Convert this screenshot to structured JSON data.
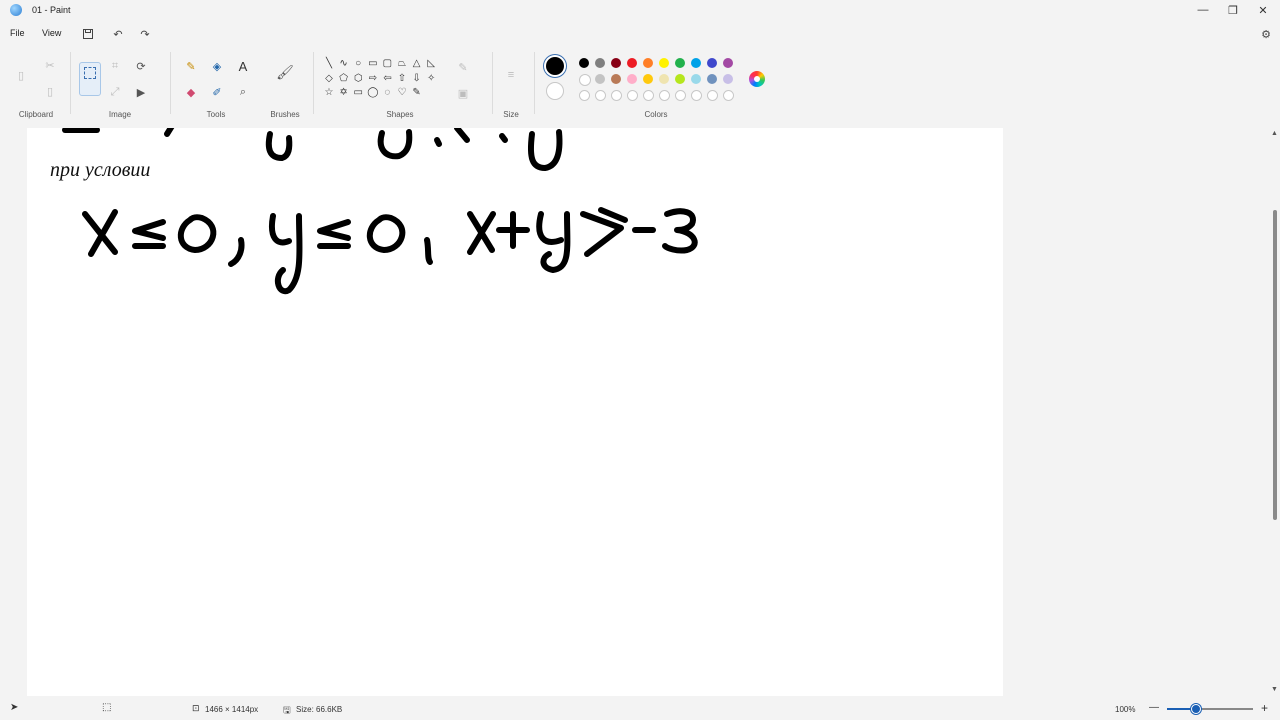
{
  "window": {
    "title": "01 - Paint",
    "controls": [
      "—",
      "❐",
      "✕"
    ]
  },
  "menu": {
    "file": "File",
    "view": "View"
  },
  "ribbon": {
    "groups": {
      "clipboard": "Clipboard",
      "image": "Image",
      "tools": "Tools",
      "brushes": "Brushes",
      "shapes": "Shapes",
      "size": "Size",
      "colors": "Colors"
    },
    "shapes": [
      "╲",
      "∿",
      "○",
      "▭",
      "▢",
      "⏢",
      "△",
      "◺",
      "◇",
      "⬠",
      "⬡",
      "⇨",
      "⇦",
      "⇧",
      "⇩",
      "✧",
      "☆",
      "✡",
      "▭",
      "◯",
      "◌",
      "♡",
      "✎"
    ],
    "primary_color": "#000000",
    "secondary_color": "#ffffff",
    "palette_row1": [
      "#000000",
      "#7f7f7f",
      "#880015",
      "#ed1c24",
      "#ff7f27",
      "#fff200",
      "#22b14c",
      "#00a2e8",
      "#3f48cc",
      "#a349a4"
    ],
    "palette_row2": [
      "#ffffff",
      "#c3c3c3",
      "#b97a57",
      "#ffaec9",
      "#ffc90e",
      "#efe4b0",
      "#b5e61d",
      "#99d9ea",
      "#7092be",
      "#c8bfe7"
    ]
  },
  "canvas": {
    "caption": "при условии",
    "handwritten_expression": "x ≤ 0, y ≤ 0, x+y ≥ -3"
  },
  "statusbar": {
    "dimensions": "1466 × 1414px",
    "size": "Size: 66.6KB",
    "zoom": "100%",
    "zoom_minus": "—",
    "zoom_plus": "+",
    "zoom_level": 0.34
  }
}
